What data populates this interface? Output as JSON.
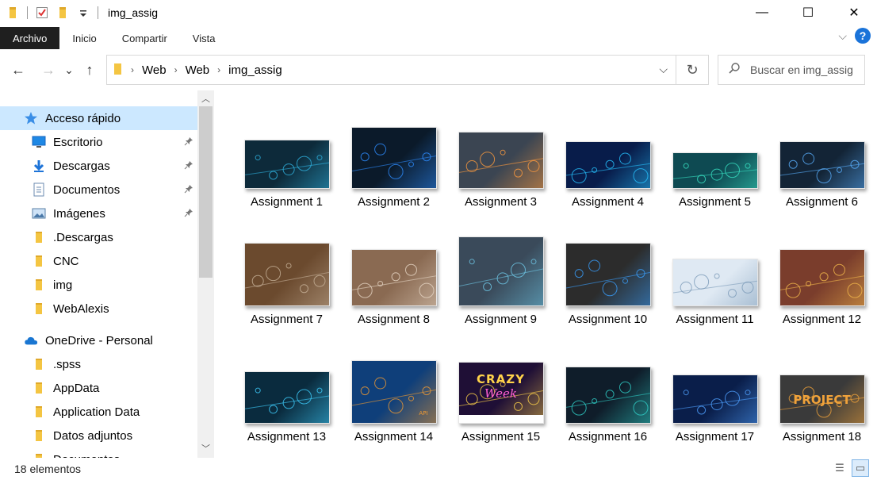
{
  "window": {
    "title": "img_assig",
    "minimize": "—",
    "maximize": "☐",
    "close": "✕"
  },
  "ribbon": {
    "tabs": [
      "Archivo",
      "Inicio",
      "Compartir",
      "Vista"
    ],
    "help": "?"
  },
  "nav": {
    "back": "←",
    "forward": "→",
    "recent": "⌄",
    "up": "↑"
  },
  "address": {
    "crumbs": [
      "Web",
      "Web",
      "img_assig"
    ],
    "separator": "›"
  },
  "search": {
    "placeholder": "Buscar en img_assig",
    "value": ""
  },
  "sidebar": {
    "items": [
      {
        "label": "Acceso rápido",
        "icon": "star-icon",
        "pinned": false,
        "selected": true,
        "indent": 0
      },
      {
        "label": "Escritorio",
        "icon": "desktop-icon",
        "pinned": true,
        "selected": false,
        "indent": 1
      },
      {
        "label": "Descargas",
        "icon": "download-icon",
        "pinned": true,
        "selected": false,
        "indent": 1
      },
      {
        "label": "Documentos",
        "icon": "document-icon",
        "pinned": true,
        "selected": false,
        "indent": 1
      },
      {
        "label": "Imágenes",
        "icon": "pictures-icon",
        "pinned": true,
        "selected": false,
        "indent": 1
      },
      {
        "label": ".Descargas",
        "icon": "folder-icon",
        "pinned": false,
        "selected": false,
        "indent": 1
      },
      {
        "label": "CNC",
        "icon": "folder-icon",
        "pinned": false,
        "selected": false,
        "indent": 1
      },
      {
        "label": "img",
        "icon": "folder-icon",
        "pinned": false,
        "selected": false,
        "indent": 1
      },
      {
        "label": "WebAlexis",
        "icon": "folder-icon",
        "pinned": false,
        "selected": false,
        "indent": 1
      },
      {
        "label": "OneDrive - Personal",
        "icon": "cloud-icon",
        "pinned": false,
        "selected": false,
        "indent": 0
      },
      {
        "label": ".spss",
        "icon": "folder-icon",
        "pinned": false,
        "selected": false,
        "indent": 1
      },
      {
        "label": "AppData",
        "icon": "folder-icon",
        "pinned": false,
        "selected": false,
        "indent": 1
      },
      {
        "label": "Application Data",
        "icon": "folder-icon",
        "pinned": false,
        "selected": false,
        "indent": 1
      },
      {
        "label": "Datos adjuntos",
        "icon": "folder-icon",
        "pinned": false,
        "selected": false,
        "indent": 1
      },
      {
        "label": "Documentos",
        "icon": "folder-icon",
        "pinned": false,
        "selected": false,
        "indent": 1
      }
    ],
    "pin_glyph": "📌"
  },
  "files": [
    {
      "name": "Assignment 1",
      "bg": "#0d2a3a",
      "accent": "#2fb3e0",
      "shape": "wide"
    },
    {
      "name": "Assignment 2",
      "bg": "#0b1a2a",
      "accent": "#2d8cff",
      "shape": "tall"
    },
    {
      "name": "Assignment 3",
      "bg": "#3b4552",
      "accent": "#ff9b3d",
      "shape": "mid"
    },
    {
      "name": "Assignment 4",
      "bg": "#081c4a",
      "accent": "#27c3ff",
      "shape": "wide"
    },
    {
      "name": "Assignment 5",
      "bg": "#0e4a52",
      "accent": "#37e0c2",
      "shape": "short"
    },
    {
      "name": "Assignment 6",
      "bg": "#132436",
      "accent": "#5ab0ff",
      "shape": "mid"
    },
    {
      "name": "Assignment 7",
      "bg": "#6b4a2e",
      "accent": "#c7b199",
      "shape": "mid"
    },
    {
      "name": "Assignment 8",
      "bg": "#8a6a52",
      "accent": "#e6d6c4",
      "shape": "mid2"
    },
    {
      "name": "Assignment 9",
      "bg": "#3a4a5a",
      "accent": "#6fc9e8",
      "shape": "tall2"
    },
    {
      "name": "Assignment 10",
      "bg": "#2c2c2c",
      "accent": "#3aa0ff",
      "shape": "mid"
    },
    {
      "name": "Assignment 11",
      "bg": "#dfe9f3",
      "accent": "#7a9ab8",
      "shape": "mid2"
    },
    {
      "name": "Assignment 12",
      "bg": "#7a3d2c",
      "accent": "#f2b84b",
      "shape": "mid"
    },
    {
      "name": "Assignment 13",
      "bg": "#0a2b3e",
      "accent": "#3fd0ff",
      "shape": "wide"
    },
    {
      "name": "Assignment 14",
      "bg": "#0f3f7a",
      "accent": "#f29b31",
      "shape": "mid"
    },
    {
      "name": "Assignment 15",
      "bg": "#1f0f36",
      "accent": "#ffd34a",
      "shape": "mid"
    },
    {
      "name": "Assignment 16",
      "bg": "#0f1d2a",
      "accent": "#2fd0c8",
      "shape": "mid"
    },
    {
      "name": "Assignment 17",
      "bg": "#0a1e4a",
      "accent": "#4fa0ff",
      "shape": "mid"
    },
    {
      "name": "Assignment 18",
      "bg": "#3a3a3a",
      "accent": "#f0a23a",
      "shape": "mid"
    }
  ],
  "thumb_texts": {
    "crazy_line1": "CRAZY",
    "crazy_line2": "Week",
    "project": "PROJECT",
    "api": "API"
  },
  "status": {
    "count": "18 elementos"
  },
  "colors": {
    "selected_bg": "#cce8ff",
    "folder": "#f2c94c",
    "accent": "#1a73d9"
  }
}
